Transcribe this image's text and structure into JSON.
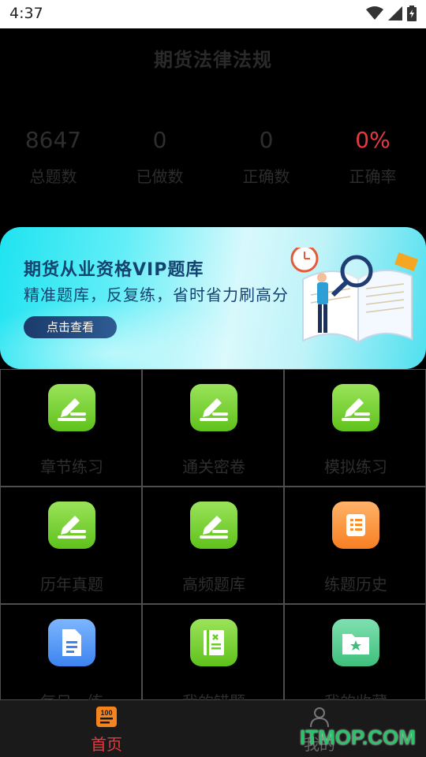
{
  "status_bar": {
    "time": "4:37"
  },
  "page": {
    "title": "期货法律法规"
  },
  "stats": [
    {
      "value": "8647",
      "label": "总题数"
    },
    {
      "value": "0",
      "label": "已做数"
    },
    {
      "value": "0",
      "label": "正确数"
    },
    {
      "value": "0%",
      "label": "正确率"
    }
  ],
  "banner": {
    "title": "期货从业资格VIP题库",
    "subtitle": "精准题库，反复练，省时省力刷高分",
    "button": "点击查看"
  },
  "grid": [
    {
      "label": "章节练习",
      "icon": "edit-icon",
      "color": "green"
    },
    {
      "label": "通关密卷",
      "icon": "edit-icon",
      "color": "green"
    },
    {
      "label": "模拟练习",
      "icon": "edit-icon",
      "color": "green"
    },
    {
      "label": "历年真题",
      "icon": "edit-icon",
      "color": "green"
    },
    {
      "label": "高频题库",
      "icon": "edit-icon",
      "color": "green"
    },
    {
      "label": "练题历史",
      "icon": "scroll-icon",
      "color": "orange"
    },
    {
      "label": "每日一练",
      "icon": "document-icon",
      "color": "blue"
    },
    {
      "label": "我的错题",
      "icon": "error-book-icon",
      "color": "green"
    },
    {
      "label": "我的收藏",
      "icon": "favorite-folder-icon",
      "color": "mint"
    }
  ],
  "bottom_nav": {
    "home": {
      "label": "首页",
      "icon": "home-100-icon"
    },
    "mine": {
      "label": "我的",
      "icon": "person-icon"
    }
  },
  "watermark": "ITMOP.COM",
  "colors": {
    "accent_red": "#e8393f",
    "icon_green": "#6ccc26",
    "banner_text": "#13436e"
  }
}
